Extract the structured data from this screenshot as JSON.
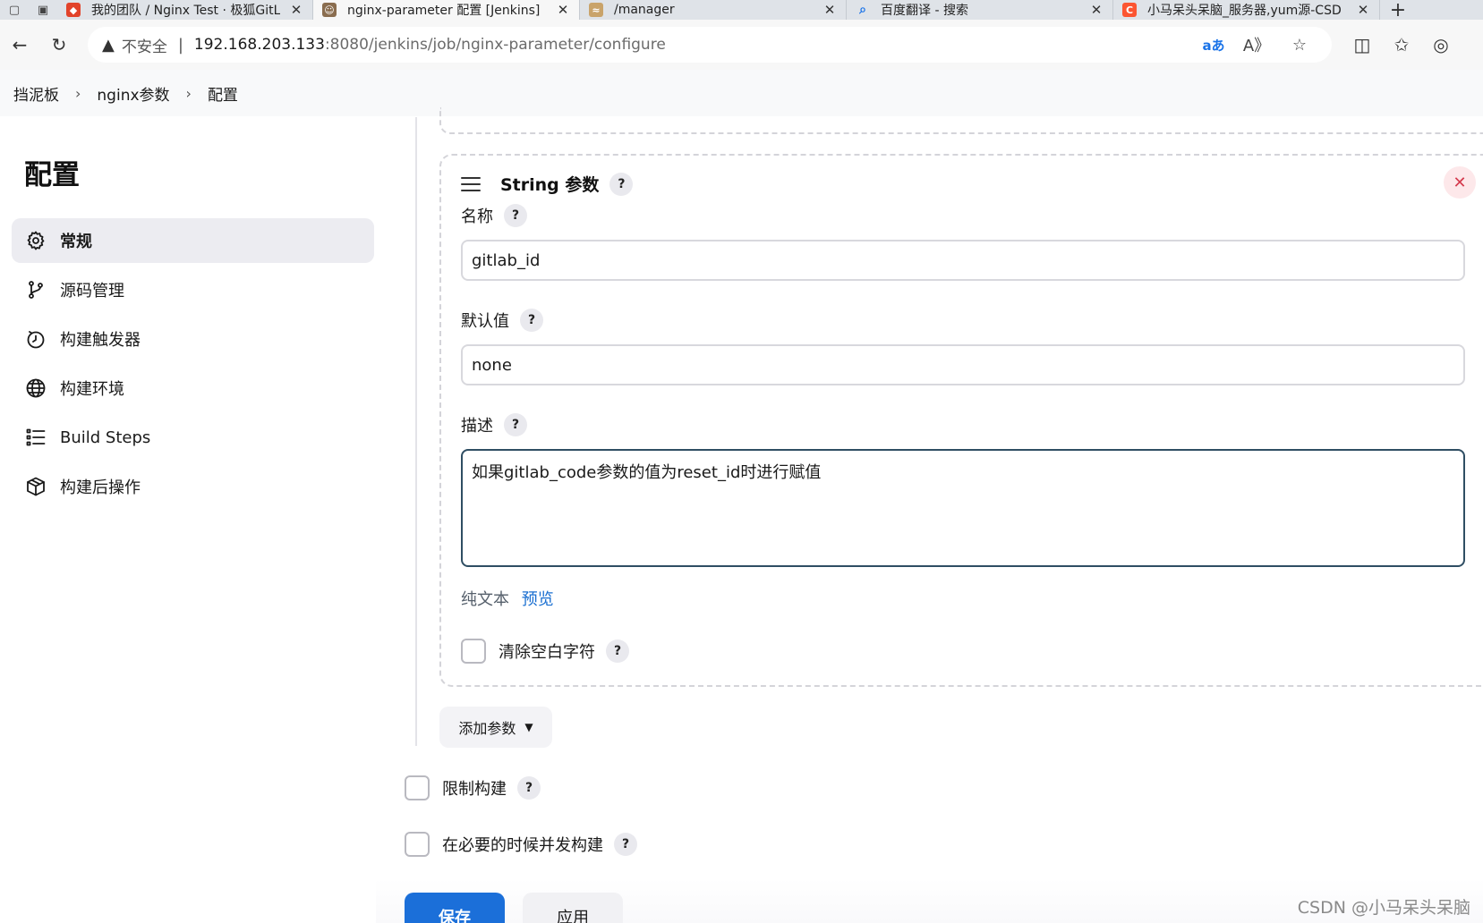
{
  "browser": {
    "tabs": [
      {
        "title": "我的团队 / Nginx Test · 极狐GitLa",
        "icon": "gitlab-fox-icon",
        "color": "#e2432a",
        "active": false
      },
      {
        "title": "nginx-parameter 配置 [Jenkins]",
        "icon": "jenkins-icon",
        "color": "#8a6d4f",
        "active": true
      },
      {
        "title": "/manager",
        "icon": "tomcat-icon",
        "color": "#c9a36a",
        "active": false
      },
      {
        "title": "百度翻译 - 搜索",
        "icon": "search-icon",
        "color": "#1a73e8",
        "active": false
      },
      {
        "title": "小马呆头呆脑_服务器,yum源-CSD",
        "icon": "csdn-icon",
        "color": "#fc5531",
        "active": false
      }
    ],
    "insecure_label": "不安全",
    "url_host": "192.168.203.133",
    "url_rest": ":8080/jenkins/job/nginx-parameter/configure",
    "translate_label": "aあ"
  },
  "breadcrumb": {
    "items": [
      "挡泥板",
      "nginx参数",
      "配置"
    ]
  },
  "sidebar": {
    "title": "配置",
    "items": [
      {
        "label": "常规",
        "icon": "gear-icon",
        "active": true
      },
      {
        "label": "源码管理",
        "icon": "branch-icon",
        "active": false
      },
      {
        "label": "构建触发器",
        "icon": "clock-icon",
        "active": false
      },
      {
        "label": "构建环境",
        "icon": "globe-icon",
        "active": false
      },
      {
        "label": "Build Steps",
        "icon": "list-icon",
        "active": false
      },
      {
        "label": "构建后操作",
        "icon": "package-icon",
        "active": false
      }
    ]
  },
  "param_card": {
    "title": "String 参数",
    "help": "?",
    "name_label": "名称",
    "name_value": "gitlab_id",
    "default_label": "默认值",
    "default_value": "none",
    "desc_label": "描述",
    "desc_value": "如果gitlab_code参数的值为reset_id时进行赋值",
    "format_plain": "纯文本",
    "format_preview": "预览",
    "trim_label": "清除空白字符",
    "delete_symbol": "✕"
  },
  "add_param_label": "添加参数",
  "options": {
    "limit_build_label": "限制构建",
    "concurrent_label": "在必要的时候并发构建"
  },
  "actions": {
    "save_label": "保存",
    "apply_label": "应用"
  },
  "watermark": "CSDN @小马呆头呆脑"
}
